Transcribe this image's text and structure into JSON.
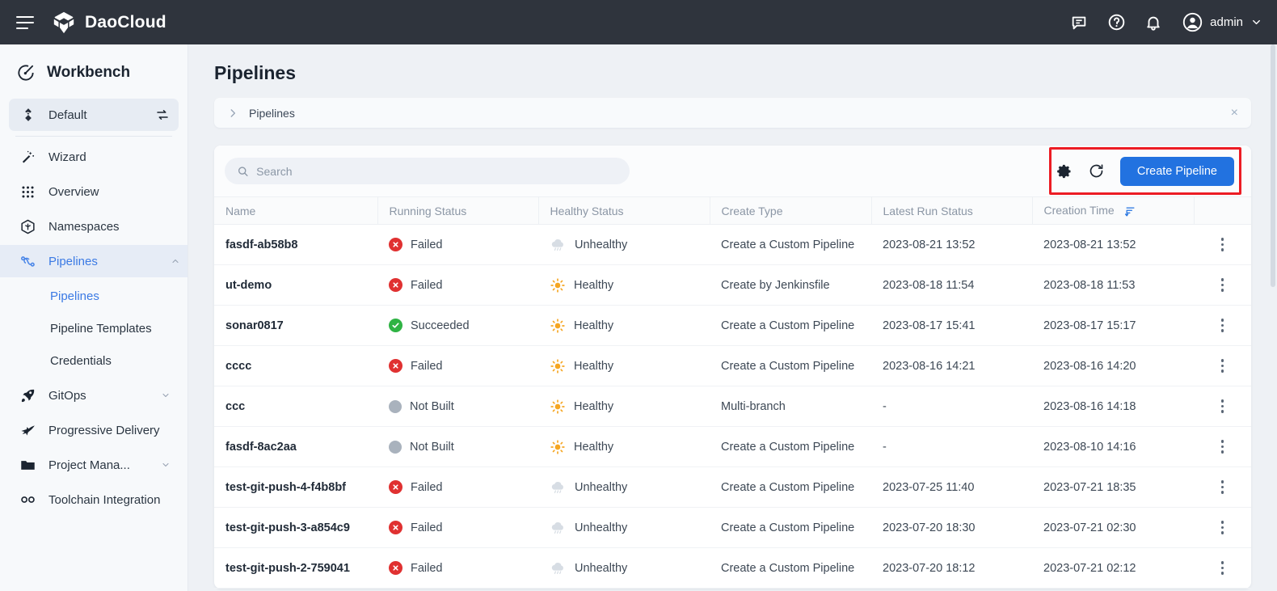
{
  "topbar": {
    "brand": "DaoCloud",
    "menu_icon": "hamburger-icon",
    "icons": [
      "message-icon",
      "help-icon",
      "bell-icon"
    ],
    "user": "admin"
  },
  "sidebar": {
    "workbench_title": "Workbench",
    "default_item": {
      "label": "Default",
      "icon": "layers-icon",
      "switch_icon": "switch-icon"
    },
    "items": [
      {
        "label": "Wizard",
        "icon": "wand-icon",
        "active": false,
        "expandable": false
      },
      {
        "label": "Overview",
        "icon": "grid-icon",
        "active": false,
        "expandable": false
      },
      {
        "label": "Namespaces",
        "icon": "cube-icon",
        "active": false,
        "expandable": false
      },
      {
        "label": "Pipelines",
        "icon": "pipelines-icon",
        "active": true,
        "expandable": true,
        "expanded": true
      }
    ],
    "sub_items": [
      {
        "label": "Pipelines",
        "active": true
      },
      {
        "label": "Pipeline Templates",
        "active": false
      },
      {
        "label": "Credentials",
        "active": false
      }
    ],
    "items_after": [
      {
        "label": "GitOps",
        "icon": "rocket-icon",
        "active": false,
        "expandable": true
      },
      {
        "label": "Progressive Delivery",
        "icon": "bird-icon",
        "active": false,
        "expandable": false
      },
      {
        "label": "Project Mana...",
        "icon": "folder-icon",
        "active": false,
        "expandable": true
      },
      {
        "label": "Toolchain Integration",
        "icon": "infinity-icon",
        "active": false,
        "expandable": false
      }
    ]
  },
  "main": {
    "page_title": "Pipelines",
    "breadcrumb": {
      "chevron": "chevron-right-icon",
      "text": "Pipelines",
      "close": "×"
    },
    "toolbar": {
      "search_placeholder": "Search",
      "search_value": "",
      "search_icon": "search-icon",
      "settings_icon": "gear-icon",
      "refresh_icon": "refresh-icon",
      "create_label": "Create Pipeline"
    },
    "table": {
      "columns": [
        "Name",
        "Running Status",
        "Healthy Status",
        "Create Type",
        "Latest Run Status",
        "Creation Time",
        ""
      ],
      "sorted_column": "Creation Time",
      "sort_direction": "descending",
      "rows": [
        {
          "name": "fasdf-ab58b8",
          "running_status": "Failed",
          "running_icon": "error-icon",
          "healthy_status": "Unhealthy",
          "healthy_icon": "rain-cloud-icon",
          "create_type": "Create a Custom Pipeline",
          "latest_run": "2023-08-21 13:52",
          "creation_time": "2023-08-21 13:52"
        },
        {
          "name": "ut-demo",
          "running_status": "Failed",
          "running_icon": "error-icon",
          "healthy_status": "Healthy",
          "healthy_icon": "sun-icon",
          "create_type": "Create by Jenkinsfile",
          "latest_run": "2023-08-18 11:54",
          "creation_time": "2023-08-18 11:53"
        },
        {
          "name": "sonar0817",
          "running_status": "Succeeded",
          "running_icon": "check-icon",
          "healthy_status": "Healthy",
          "healthy_icon": "sun-icon",
          "create_type": "Create a Custom Pipeline",
          "latest_run": "2023-08-17 15:41",
          "creation_time": "2023-08-17 15:17"
        },
        {
          "name": "cccc",
          "running_status": "Failed",
          "running_icon": "error-icon",
          "healthy_status": "Healthy",
          "healthy_icon": "sun-icon",
          "create_type": "Create a Custom Pipeline",
          "latest_run": "2023-08-16 14:21",
          "creation_time": "2023-08-16 14:20"
        },
        {
          "name": "ccc",
          "running_status": "Not Built",
          "running_icon": "grey-dot-icon",
          "healthy_status": "Healthy",
          "healthy_icon": "sun-icon",
          "create_type": "Multi-branch",
          "latest_run": "-",
          "creation_time": "2023-08-16 14:18"
        },
        {
          "name": "fasdf-8ac2aa",
          "running_status": "Not Built",
          "running_icon": "grey-dot-icon",
          "healthy_status": "Healthy",
          "healthy_icon": "sun-icon",
          "create_type": "Create a Custom Pipeline",
          "latest_run": "-",
          "creation_time": "2023-08-10 14:16"
        },
        {
          "name": "test-git-push-4-f4b8bf",
          "running_status": "Failed",
          "running_icon": "error-icon",
          "healthy_status": "Unhealthy",
          "healthy_icon": "rain-cloud-icon",
          "create_type": "Create a Custom Pipeline",
          "latest_run": "2023-07-25 11:40",
          "creation_time": "2023-07-21 18:35"
        },
        {
          "name": "test-git-push-3-a854c9",
          "running_status": "Failed",
          "running_icon": "error-icon",
          "healthy_status": "Unhealthy",
          "healthy_icon": "rain-cloud-icon",
          "create_type": "Create a Custom Pipeline",
          "latest_run": "2023-07-20 18:30",
          "creation_time": "2023-07-21 02:30"
        },
        {
          "name": "test-git-push-2-759041",
          "running_status": "Failed",
          "running_icon": "error-icon",
          "healthy_status": "Unhealthy",
          "healthy_icon": "rain-cloud-icon",
          "create_type": "Create a Custom Pipeline",
          "latest_run": "2023-07-20 18:12",
          "creation_time": "2023-07-21 02:12"
        }
      ]
    }
  },
  "colors": {
    "accent": "#2272e0",
    "topbar_bg": "#2f343d",
    "sidebar_bg": "#f7f9fb",
    "fail": "#e03131",
    "success": "#2fb344",
    "healthy": "#f5a623",
    "neutral": "#a9b2bd",
    "highlight": "#ec1c24"
  }
}
